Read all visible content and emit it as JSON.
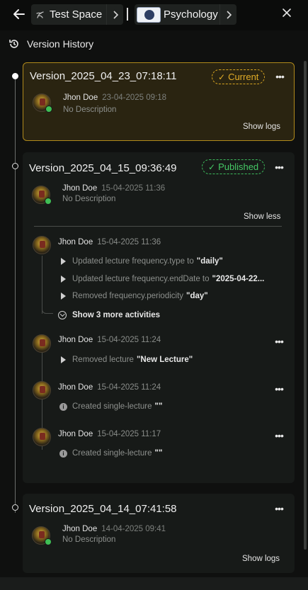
{
  "topbar": {
    "back_icon": "arrow-left-icon",
    "space_label": "Test Space",
    "course_label": "Psychology",
    "close_icon": "close-icon"
  },
  "header": {
    "title": "Version History",
    "icon": "history-icon"
  },
  "versions": [
    {
      "title": "Version_2025_04_23_07:18:11",
      "tag": "Current",
      "author": "Jhon Doe",
      "date": "23-04-2025 09:18",
      "description": "No Description",
      "toggle": "Show logs"
    },
    {
      "title": "Version_2025_04_15_09:36:49",
      "tag": "Published",
      "author": "Jhon Doe",
      "date": "15-04-2025 11:36",
      "description": "No Description",
      "toggle": "Show less",
      "logs": [
        {
          "author": "Jhon Doe",
          "date": "15-04-2025 11:36",
          "activities": [
            {
              "text": "Updated lecture frequency.type to",
              "value": "\"daily\""
            },
            {
              "text": "Updated lecture frequency.endDate to",
              "value": "\"2025-04-22..."
            },
            {
              "text": "Removed frequency.periodicity",
              "value": "\"day\""
            }
          ],
          "more": "Show 3 more activities"
        },
        {
          "author": "Jhon Doe",
          "date": "15-04-2025 11:24",
          "activities": [
            {
              "text": "Removed lecture",
              "value": "\"New Lecture\""
            }
          ]
        },
        {
          "author": "Jhon Doe",
          "date": "15-04-2025 11:24",
          "activities": [
            {
              "text": "Created single-lecture",
              "value": "\"\""
            }
          ]
        },
        {
          "author": "Jhon Doe",
          "date": "15-04-2025 11:17",
          "activities": [
            {
              "text": "Created single-lecture",
              "value": "\"\""
            }
          ]
        }
      ]
    },
    {
      "title": "Version_2025_04_14_07:41:58",
      "author": "Jhon Doe",
      "date": "14-04-2025 09:41",
      "description": "No Description",
      "toggle": "Show logs"
    }
  ],
  "colors": {
    "current_accent": "#d9a520",
    "published_accent": "#3dbb5c",
    "background": "#0f100f",
    "card": "#171a18"
  }
}
